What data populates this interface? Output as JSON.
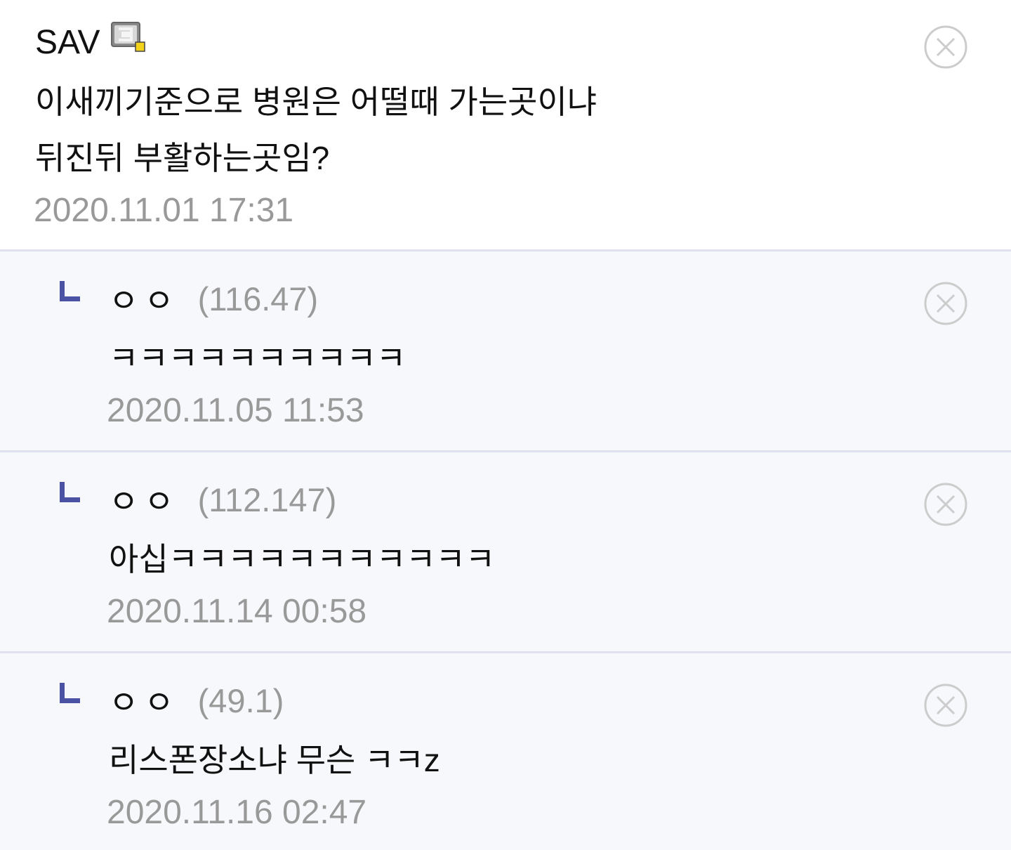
{
  "colors": {
    "text": "#111111",
    "meta": "#999999",
    "reply_arrow": "#4b52a3",
    "reply_background": "#f7f8fb",
    "divider": "#dfe1ee",
    "close_icon": "#cccccc",
    "nick_icon_badge": "#f2d21b"
  },
  "comment": {
    "author": "SAV",
    "author_icon": "gallery-nick-icon",
    "text_lines": [
      "이새끼기준으로 병원은 어떨때 가는곳이냐",
      "뒤진뒤 부활하는곳임?"
    ],
    "timestamp": "2020.11.01 17:31",
    "close_icon": "close-circle-icon"
  },
  "replies": [
    {
      "arrow_icon": "reply-arrow-icon",
      "author": "ㅇㅇ",
      "ip": "(116.47)",
      "text": "ㅋㅋㅋㅋㅋㅋㅋㅋㅋㅋ",
      "timestamp": "2020.11.05 11:53",
      "close_icon": "close-circle-icon"
    },
    {
      "arrow_icon": "reply-arrow-icon",
      "author": "ㅇㅇ",
      "ip": "(112.147)",
      "text": "아십ㅋㅋㅋㅋㅋㅋㅋㅋㅋㅋㅋ",
      "timestamp": "2020.11.14 00:58",
      "close_icon": "close-circle-icon"
    },
    {
      "arrow_icon": "reply-arrow-icon",
      "author": "ㅇㅇ",
      "ip": "(49.1)",
      "text": "리스폰장소냐 무슨 ㅋㅋz",
      "timestamp": "2020.11.16 02:47",
      "close_icon": "close-circle-icon"
    }
  ]
}
